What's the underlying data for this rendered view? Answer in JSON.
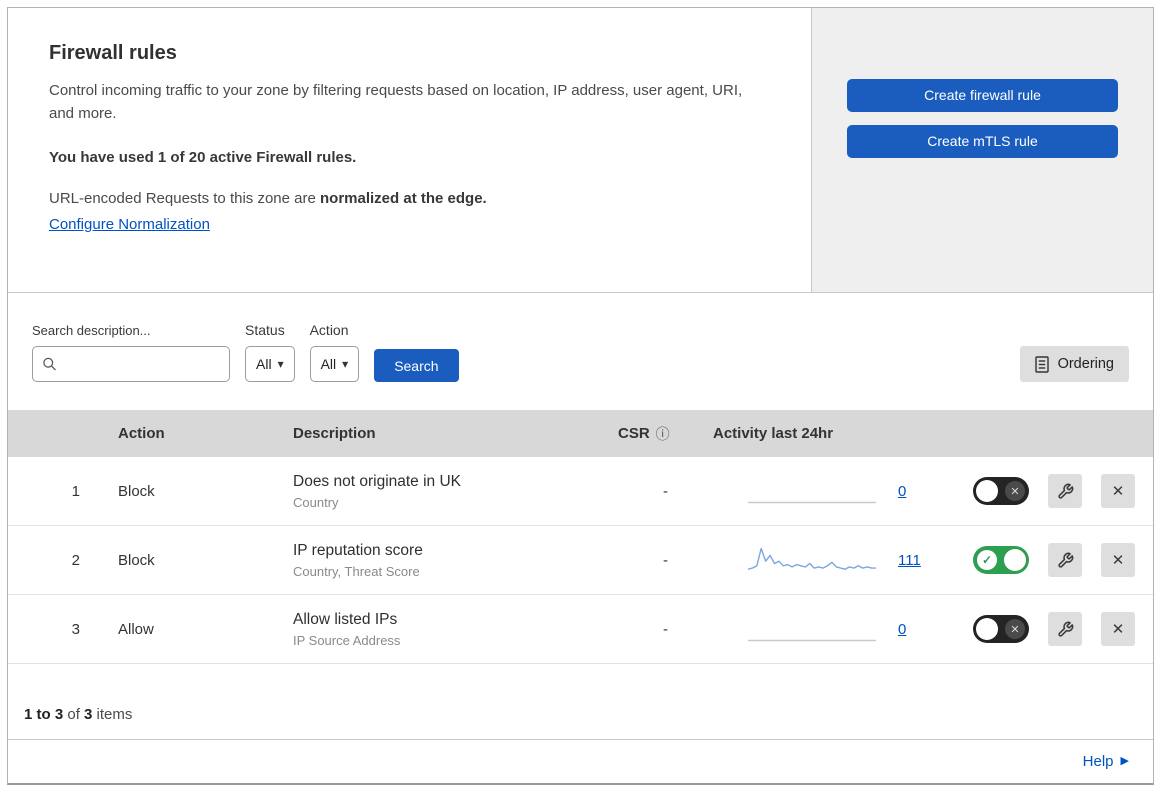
{
  "colors": {
    "accent_blue": "#1a5dbe",
    "link_blue": "#0051c3",
    "toggle_on_green": "#2e9e50",
    "toggle_off_dark": "#242424",
    "sparkline": "#7aa7e0",
    "flatline": "#c6cbd1",
    "panel_gray": "#efefef",
    "table_header_gray": "#d8d8d8"
  },
  "icons": {
    "info": "ⓘ",
    "caret": "▾",
    "help_arrow": "▶",
    "check": "✓",
    "cross": "✕"
  },
  "header": {
    "title": "Firewall rules",
    "description": "Control incoming traffic to your zone by filtering requests based on location, IP address, user agent, URI, and more.",
    "usage": "You have used 1 of 20 active Firewall rules.",
    "normalization_prefix": "URL-encoded Requests to this zone are ",
    "normalization_bold": "normalized at the edge.",
    "normalization_link": "Configure Normalization",
    "create_firewall_button": "Create firewall rule",
    "create_mtls_button": "Create mTLS rule"
  },
  "filters": {
    "search_label": "Search description...",
    "status_label": "Status",
    "status_value": "All",
    "action_label": "Action",
    "action_value": "All",
    "search_button": "Search",
    "ordering_button": "Ordering"
  },
  "table": {
    "headers": {
      "action": "Action",
      "description": "Description",
      "csr": "CSR",
      "activity": "Activity last 24hr"
    },
    "rows": [
      {
        "index": "1",
        "action": "Block",
        "description": "Does not originate in UK",
        "criteria": "Country",
        "csr": "-",
        "activity_count": "0",
        "enabled": false,
        "sparkline": []
      },
      {
        "index": "2",
        "action": "Block",
        "description": "IP reputation score",
        "criteria": "Country, Threat Score",
        "csr": "-",
        "activity_count": "111",
        "enabled": true,
        "sparkline": [
          2,
          3,
          5,
          20,
          9,
          14,
          7,
          9,
          5,
          6,
          4,
          6,
          5,
          4,
          7,
          3,
          4,
          3,
          5,
          8,
          4,
          3,
          2,
          4,
          3,
          5,
          3,
          4,
          3,
          3
        ]
      },
      {
        "index": "3",
        "action": "Allow",
        "description": "Allow listed IPs",
        "criteria": "IP Source Address",
        "csr": "-",
        "activity_count": "0",
        "enabled": false,
        "sparkline": []
      }
    ],
    "summary": {
      "range": "1 to 3",
      "of": " of ",
      "total": "3",
      "items": " items"
    }
  },
  "help": {
    "label": "Help"
  }
}
